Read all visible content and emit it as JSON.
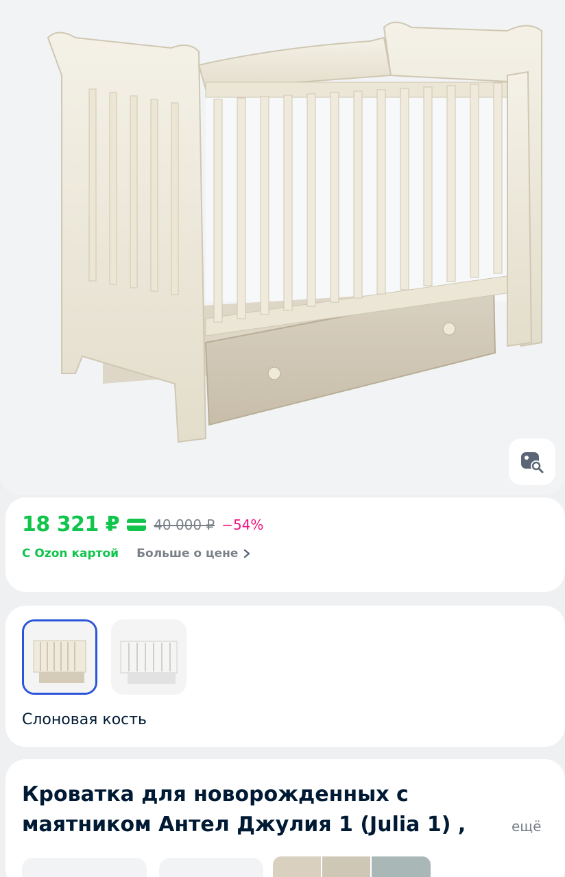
{
  "hero": {
    "image_alt": "Кроватка для новорожденных",
    "search_icon": "image-search-icon"
  },
  "price": {
    "current": "18 321 ₽",
    "card_icon": "ozon-card-icon",
    "old": "40 000 ₽",
    "discount": "−54%",
    "ozon_card_label": "С Ozon картой",
    "more_label": "Больше о цене",
    "more_icon": "chevron-right-icon"
  },
  "colors": {
    "price_green": "#10c44c",
    "discount_pink": "#f1117e",
    "selected_border": "#2b55d9",
    "text_dark": "#001a34",
    "text_muted": "#7a8087"
  },
  "variants": {
    "selected_name": "Слоновая кость",
    "items": [
      {
        "id": "ivory",
        "selected": true
      },
      {
        "id": "white",
        "selected": false
      }
    ]
  },
  "product": {
    "title": "Кроватка для новорожденных с маятником Антел Джулия 1 (Julia 1) ,",
    "more_label": "ещё"
  }
}
